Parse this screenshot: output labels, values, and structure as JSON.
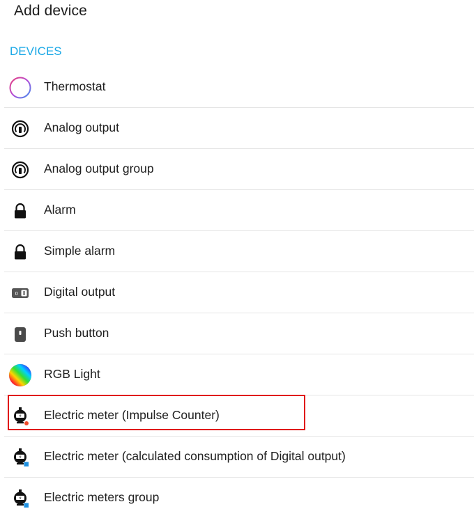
{
  "header": {
    "title": "Add device"
  },
  "section": {
    "title": "DEVICES"
  },
  "items": [
    {
      "label": "Thermostat",
      "icon": "thermostat-icon"
    },
    {
      "label": "Analog output",
      "icon": "analog-output-icon"
    },
    {
      "label": "Analog output group",
      "icon": "analog-output-group-icon"
    },
    {
      "label": "Alarm",
      "icon": "lock-icon"
    },
    {
      "label": "Simple alarm",
      "icon": "lock-icon"
    },
    {
      "label": "Digital output",
      "icon": "digital-output-icon"
    },
    {
      "label": "Push button",
      "icon": "push-button-icon"
    },
    {
      "label": "RGB Light",
      "icon": "rgb-light-icon"
    },
    {
      "label": "Electric meter (Impulse Counter)",
      "icon": "electric-meter-impulse-icon"
    },
    {
      "label": "Electric meter (calculated consumption of Digital output)",
      "icon": "electric-meter-digital-icon"
    },
    {
      "label": "Electric meters group",
      "icon": "electric-meters-group-icon"
    }
  ],
  "colors": {
    "accent": "#1ba8e6",
    "highlight_border": "#e01010",
    "impulse_badge": "#f04a2a",
    "digital_badge": "#1e90e0"
  }
}
